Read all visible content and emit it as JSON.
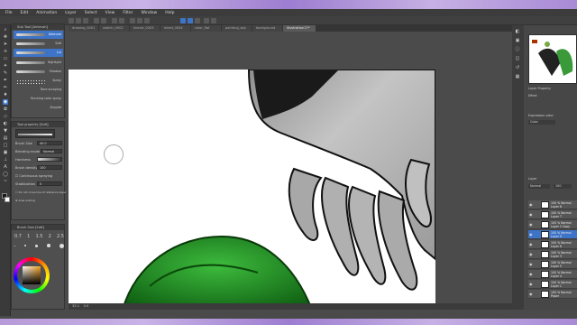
{
  "menu": [
    "File",
    "Edit",
    "Animation",
    "Layer",
    "Select",
    "View",
    "Filter",
    "Window",
    "Help"
  ],
  "tabs": [
    {
      "label": "drawing_0001"
    },
    {
      "label": "sketch_0002"
    },
    {
      "label": "lineart_0003"
    },
    {
      "label": "inked_0004"
    },
    {
      "label": "color_flat"
    },
    {
      "label": "painting_wip"
    },
    {
      "label": "background"
    },
    {
      "label": "illustration17*"
    }
  ],
  "sub_tool": {
    "header": "Sub Tool [Airbrush]",
    "brushes": [
      "Airbrush",
      "Soft",
      "Lin",
      "Highlight",
      "Shadow",
      "Spray",
      "Tone scraping",
      "Running color spray",
      "Droplet"
    ]
  },
  "tool_property": {
    "header": "Tool property [Soft]",
    "current": "Soft",
    "brush_size_label": "Brush Size",
    "brush_size_value": "40.0",
    "blending_mode_label": "Blending mode",
    "blending_mode_value": "Normal",
    "hardness_label": "Hardness",
    "brush_density_label": "Brush density",
    "brush_density_value": "100",
    "continuous_spraying": "Continuous spraying",
    "stabilization_label": "Stabilization",
    "stabilization_value": "0",
    "do_not_cross_label": "Do not cross line of reference layer",
    "area_scaling": "Area scaling"
  },
  "brush_size_panel": {
    "header": "Brush Size [Soft]",
    "sizes": [
      "0.7",
      "1",
      "1.5",
      "2",
      "2.5"
    ]
  },
  "status": {
    "zoom": "33.1",
    "angle": "0.0"
  },
  "layer_property": {
    "header": "Layer Property",
    "effect_label": "Effect",
    "expression_color_label": "Expression color",
    "expression_color_value": "Color"
  },
  "layer_panel": {
    "header": "Layer",
    "blend_mode": "Normal",
    "opacity": "100",
    "layers": [
      {
        "name": "100 % Normal",
        "sub": "Layer 8",
        "selected": false
      },
      {
        "name": "100 % Normal",
        "sub": "Layer 7",
        "selected": false
      },
      {
        "name": "100 % Normal",
        "sub": "Layer 2 Copy",
        "selected": false
      },
      {
        "name": "100 % Normal",
        "sub": "Layer 9",
        "selected": true
      },
      {
        "name": "100 % Normal",
        "sub": "Layer 6",
        "selected": false
      },
      {
        "name": "100 % Normal",
        "sub": "Layer 3",
        "selected": false
      },
      {
        "name": "100 % Normal",
        "sub": "Layer 5",
        "selected": false
      },
      {
        "name": "100 % Normal",
        "sub": "Layer 4",
        "selected": false
      },
      {
        "name": "100 % Normal",
        "sub": "Layer 1",
        "selected": false
      },
      {
        "name": "100 % Normal",
        "sub": "Paper",
        "selected": false
      }
    ]
  },
  "colors": {
    "accent": "#3d74c8",
    "skin_gray": "#b8b8b8",
    "leaf_green": "#1f8a1f",
    "hair": "#1a1a1a"
  }
}
